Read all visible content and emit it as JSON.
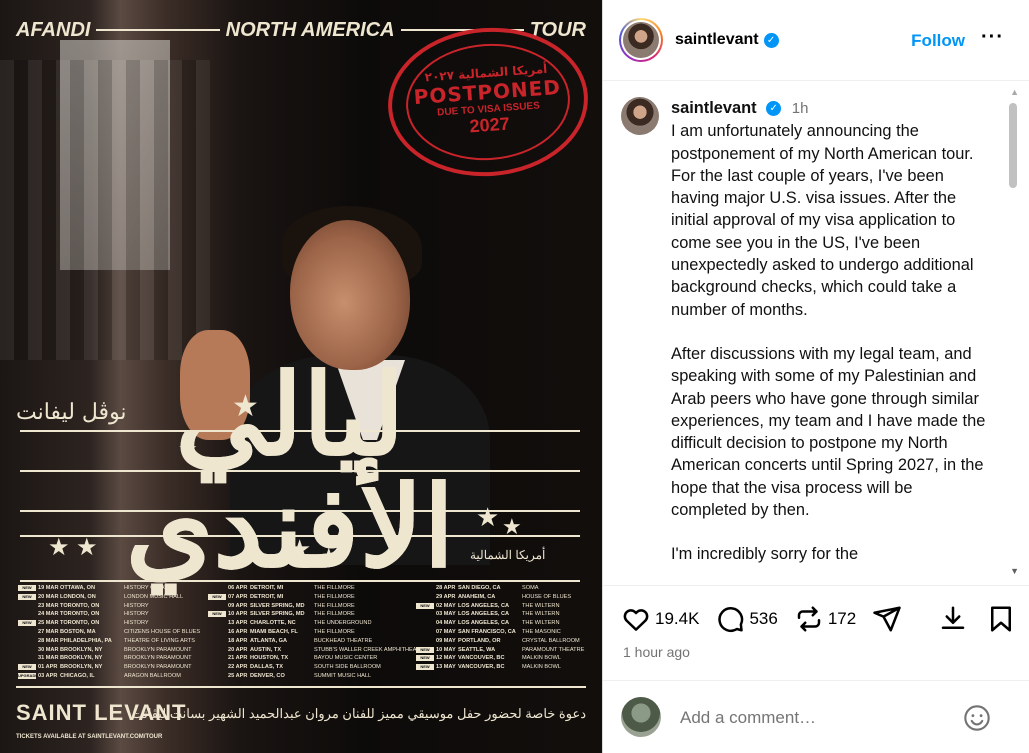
{
  "poster": {
    "top_left": "AFANDI",
    "top_center": "NORTH AMERICA",
    "top_right": "TOUR",
    "stamp": {
      "arabic": "أمريكا الشمالية ٢٠٢٧",
      "postponed": "POSTPONED",
      "reason": "DUE TO VISA ISSUES",
      "year": "2027"
    },
    "title_arabic": "ليالي الأفندي",
    "script_arabic": "نوڤل ليفانت",
    "region_arabic": "أمريكا الشمالية",
    "brand": "SAINT LEVANT",
    "tickets": "TICKETS AVAILABLE AT SAINTLEVANT.COM/TOUR",
    "footer_arabic": "دعوة خاصة لحضور حفل موسيقي مميز للفنان مروان عبدالحميد الشهير بسانت ليڤانت",
    "dates_col1": [
      {
        "tag": "NEW",
        "d": "19 MAR",
        "c": "OTTAWA, ON",
        "v": "HISTORY OTTAWA"
      },
      {
        "tag": "NEW",
        "d": "20 MAR",
        "c": "LONDON, ON",
        "v": "LONDON MUSIC HALL"
      },
      {
        "tag": "",
        "d": "23 MAR",
        "c": "TORONTO, ON",
        "v": "HISTORY"
      },
      {
        "tag": "",
        "d": "24 MAR",
        "c": "TORONTO, ON",
        "v": "HISTORY"
      },
      {
        "tag": "NEW",
        "d": "25 MAR",
        "c": "TORONTO, ON",
        "v": "HISTORY"
      },
      {
        "tag": "",
        "d": "27 MAR",
        "c": "BOSTON, MA",
        "v": "CITIZENS HOUSE OF BLUES"
      },
      {
        "tag": "",
        "d": "28 MAR",
        "c": "PHILADELPHIA, PA",
        "v": "THEATRE OF LIVING ARTS"
      },
      {
        "tag": "",
        "d": "30 MAR",
        "c": "BROOKLYN, NY",
        "v": "BROOKLYN PARAMOUNT"
      },
      {
        "tag": "",
        "d": "31 MAR",
        "c": "BROOKLYN, NY",
        "v": "BROOKLYN PARAMOUNT"
      },
      {
        "tag": "NEW",
        "d": "01 APR",
        "c": "BROOKLYN, NY",
        "v": "BROOKLYN PARAMOUNT"
      },
      {
        "tag": "UPGRADE",
        "d": "03 APR",
        "c": "CHICAGO, IL",
        "v": "ARAGON BALLROOM"
      }
    ],
    "dates_col2": [
      {
        "tag": "",
        "d": "06 APR",
        "c": "DETROIT, MI",
        "v": "THE FILLMORE"
      },
      {
        "tag": "NEW",
        "d": "07 APR",
        "c": "DETROIT, MI",
        "v": "THE FILLMORE"
      },
      {
        "tag": "",
        "d": "09 APR",
        "c": "SILVER SPRING, MD",
        "v": "THE FILLMORE"
      },
      {
        "tag": "NEW",
        "d": "10 APR",
        "c": "SILVER SPRING, MD",
        "v": "THE FILLMORE"
      },
      {
        "tag": "",
        "d": "13 APR",
        "c": "CHARLOTTE, NC",
        "v": "THE UNDERGROUND"
      },
      {
        "tag": "",
        "d": "16 APR",
        "c": "MIAMI BEACH, FL",
        "v": "THE FILLMORE"
      },
      {
        "tag": "",
        "d": "18 APR",
        "c": "ATLANTA, GA",
        "v": "BUCKHEAD THEATRE"
      },
      {
        "tag": "",
        "d": "20 APR",
        "c": "AUSTIN, TX",
        "v": "STUBB'S WALLER CREEK AMPHITHEATER"
      },
      {
        "tag": "",
        "d": "21 APR",
        "c": "HOUSTON, TX",
        "v": "BAYOU MUSIC CENTER"
      },
      {
        "tag": "",
        "d": "22 APR",
        "c": "DALLAS, TX",
        "v": "SOUTH SIDE BALLROOM"
      },
      {
        "tag": "",
        "d": "25 APR",
        "c": "DENVER, CO",
        "v": "SUMMIT MUSIC HALL"
      }
    ],
    "dates_col3": [
      {
        "tag": "",
        "d": "28 APR",
        "c": "SAN DIEGO, CA",
        "v": "SOMA"
      },
      {
        "tag": "",
        "d": "29 APR",
        "c": "ANAHEIM, CA",
        "v": "HOUSE OF BLUES"
      },
      {
        "tag": "NEW",
        "d": "02 MAY",
        "c": "LOS ANGELES, CA",
        "v": "THE WILTERN"
      },
      {
        "tag": "",
        "d": "03 MAY",
        "c": "LOS ANGELES, CA",
        "v": "THE WILTERN"
      },
      {
        "tag": "",
        "d": "04 MAY",
        "c": "LOS ANGELES, CA",
        "v": "THE WILTERN"
      },
      {
        "tag": "",
        "d": "07 MAY",
        "c": "SAN FRANCISCO, CA",
        "v": "THE MASONIC"
      },
      {
        "tag": "",
        "d": "09 MAY",
        "c": "PORTLAND, OR",
        "v": "CRYSTAL BALLROOM"
      },
      {
        "tag": "NEW",
        "d": "10 MAY",
        "c": "SEATTLE, WA",
        "v": "PARAMOUNT THEATRE"
      },
      {
        "tag": "NEW",
        "d": "12 MAY",
        "c": "VANCOUVER, BC",
        "v": "MALKIN BOWL"
      },
      {
        "tag": "NEW",
        "d": "13 MAY",
        "c": "VANCOUVER, BC",
        "v": "MALKIN BOWL"
      }
    ]
  },
  "header": {
    "username": "saintlevant",
    "verified_mark": "✓",
    "follow_label": "Follow",
    "more_label": "···"
  },
  "caption": {
    "username": "saintlevant",
    "time": "1h",
    "paragraph1": "I am unfortunately announcing the postponement of my North American tour. For the last couple of years, I've been having major U.S. visa issues. After the initial approval of my visa application to come see you in the US, I've been unexpectedly asked to undergo additional background checks, which could take a number of months.",
    "paragraph2": "After discussions with my legal team, and speaking with some of my Palestinian and Arab peers who have gone through similar experiences, my team and I have made the difficult decision to postpone my North American concerts until Spring 2027, in the hope that the visa process will be completed by then.",
    "paragraph3": "I'm incredibly sorry for the"
  },
  "actions": {
    "likes": "19.4K",
    "comments": "536",
    "reposts": "172"
  },
  "posted_ago": "1 hour ago",
  "comment": {
    "placeholder": "Add a comment…"
  }
}
